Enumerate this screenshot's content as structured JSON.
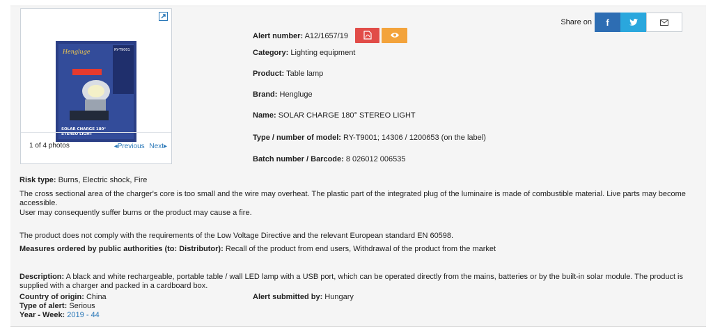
{
  "photo": {
    "count_text": "1 of 4 photos",
    "previous": "Previous",
    "next": "Next"
  },
  "product_image": {
    "brand_script": "Hengluge",
    "model_label": "RY-T9001",
    "box_line_1": "SOLAR CHARGE 180°",
    "box_line_2": "STEREO LIGHT"
  },
  "share": {
    "label": "Share on",
    "facebook": "f"
  },
  "alert": {
    "number_label": "Alert number:",
    "number_value": "A12/1657/19",
    "category_label": "Category:",
    "category_value": "Lighting equipment",
    "product_label": "Product:",
    "product_value": "Table lamp",
    "brand_label": "Brand:",
    "brand_value": "Hengluge",
    "name_label": "Name:",
    "name_value": "SOLAR CHARGE 180° STEREO LIGHT",
    "type_label": "Type / number of model:",
    "type_value": "RY-T9001; 14306 / 1200653 (on the label)",
    "batch_label": "Batch number / Barcode:",
    "batch_value": "8 026012 006535"
  },
  "risk": {
    "type_label": "Risk type:",
    "type_value": "Burns, Electric shock, Fire",
    "description": "The cross sectional area of the charger's core is too small and the wire may overheat. The plastic part of the integrated plug of the luminaire is made of combustible material. Live parts may become accessible.",
    "consequence": "User may consequently suffer burns or the product may cause a fire.",
    "compliance": "The product does not comply with the requirements of the Low Voltage Directive and the relevant European standard EN 60598."
  },
  "measures": {
    "label": "Measures ordered by public authorities (to: Distributor):",
    "value": "Recall of the product from end users, Withdrawal of the product from the market"
  },
  "details": {
    "description_label": "Description:",
    "description_value": "A black and white rechargeable, portable table / wall LED lamp with a USB port, which can be operated directly from the mains, batteries or by the built-in solar module. The product is supplied with a charger and packed in a cardboard box.",
    "country_label": "Country of origin:",
    "country_value": "China",
    "submitted_label": "Alert submitted by:",
    "submitted_value": "Hungary",
    "alert_type_label": "Type of alert:",
    "alert_type_value": "Serious",
    "year_week_label": "Year - Week:",
    "year_week_value": "2019 - 44"
  },
  "colors": {
    "pdf_button": "#e14c48",
    "eye_button": "#f3a33b",
    "facebook": "#2d6db3",
    "twitter": "#2aa7dd",
    "link": "#2a78b8"
  }
}
